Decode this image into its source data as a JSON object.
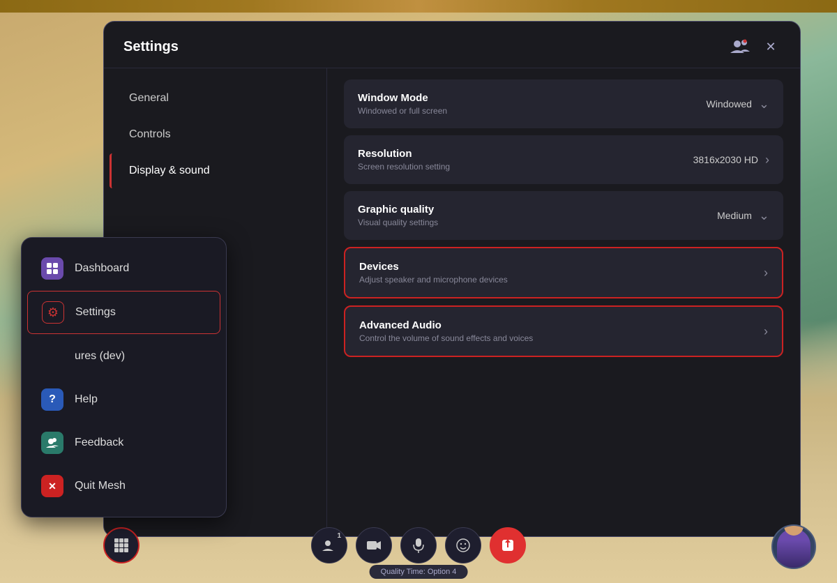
{
  "background": {
    "ceiling_color": "#8B6914"
  },
  "settings_window": {
    "title": "Settings",
    "sidebar": {
      "items": [
        {
          "id": "general",
          "label": "General",
          "active": false
        },
        {
          "id": "controls",
          "label": "Controls",
          "active": false
        },
        {
          "id": "display-sound",
          "label": "Display & sound",
          "active": true
        }
      ]
    },
    "content": {
      "rows": [
        {
          "id": "window-mode",
          "title": "Window Mode",
          "subtitle": "Windowed or full screen",
          "value": "Windowed",
          "type": "dropdown",
          "highlighted": false
        },
        {
          "id": "resolution",
          "title": "Resolution",
          "subtitle": "Screen resolution setting",
          "value": "3816x2030 HD",
          "type": "arrow",
          "highlighted": false
        },
        {
          "id": "graphic-quality",
          "title": "Graphic quality",
          "subtitle": "Visual quality settings",
          "value": "Medium",
          "type": "dropdown",
          "highlighted": false
        },
        {
          "id": "devices",
          "title": "Devices",
          "subtitle": "Adjust speaker and microphone devices",
          "value": "",
          "type": "arrow",
          "highlighted": true
        },
        {
          "id": "advanced-audio",
          "title": "Advanced Audio",
          "subtitle": "Control the volume of sound effects and voices",
          "value": "",
          "type": "arrow",
          "highlighted": true
        }
      ]
    }
  },
  "context_menu": {
    "items": [
      {
        "id": "dashboard",
        "label": "Dashboard",
        "icon": "⊞",
        "icon_type": "purple",
        "active": false
      },
      {
        "id": "settings",
        "label": "Settings",
        "icon": "⚙",
        "icon_type": "gear",
        "active": true
      },
      {
        "id": "features",
        "label": "ures (dev)",
        "icon": "",
        "icon_type": "none",
        "active": false
      },
      {
        "id": "help",
        "label": "Help",
        "icon": "?",
        "icon_type": "blue",
        "active": false
      },
      {
        "id": "feedback",
        "label": "Feedback",
        "icon": "👥",
        "icon_type": "teal",
        "active": false
      },
      {
        "id": "quit",
        "label": "Quit Mesh",
        "icon": "✕",
        "icon_type": "red",
        "active": false
      }
    ]
  },
  "taskbar": {
    "buttons": [
      {
        "id": "people",
        "icon": "👤",
        "label": "people",
        "count": "1",
        "active": false
      },
      {
        "id": "camera",
        "icon": "📷",
        "label": "camera",
        "active": false
      },
      {
        "id": "mic",
        "icon": "🎤",
        "label": "microphone",
        "active": false
      },
      {
        "id": "emoji",
        "icon": "😊",
        "label": "emoji",
        "active": false
      },
      {
        "id": "share",
        "icon": "⬆",
        "label": "share",
        "active": true
      }
    ]
  },
  "status_bar": {
    "text": "Quality Time: Option 4"
  },
  "grid_button": {
    "icon": "⊞"
  }
}
